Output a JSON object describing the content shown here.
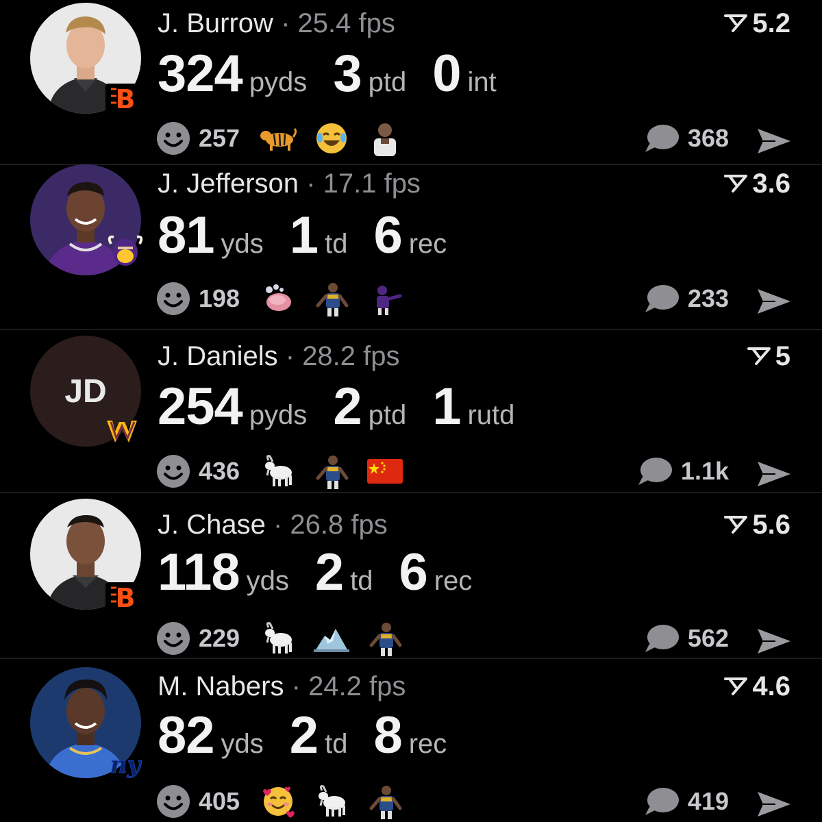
{
  "separator": "·",
  "cards": [
    {
      "name": "J. Burrow",
      "fps": "25.4 fps",
      "projection": "5.2",
      "stats": [
        {
          "value": "324",
          "unit": "pyds"
        },
        {
          "value": "3",
          "unit": "ptd"
        },
        {
          "value": "0",
          "unit": "int"
        }
      ],
      "reaction_count": "257",
      "reaction_emojis": [
        "tiger-emoji",
        "tears-of-joy-emoji",
        "player-sticker"
      ],
      "comment_count": "368",
      "team_icon": "bengals-logo-icon"
    },
    {
      "name": "J. Jefferson",
      "fps": "17.1 fps",
      "projection": "3.6",
      "stats": [
        {
          "value": "81",
          "unit": "yds"
        },
        {
          "value": "1",
          "unit": "td"
        },
        {
          "value": "6",
          "unit": "rec"
        }
      ],
      "reaction_count": "198",
      "reaction_emojis": [
        "soap-emoji",
        "player-sticker",
        "player-sticker"
      ],
      "comment_count": "233",
      "team_icon": "vikings-logo-icon"
    },
    {
      "name": "J. Daniels",
      "initials": "JD",
      "fps": "28.2 fps",
      "projection": "5",
      "stats": [
        {
          "value": "254",
          "unit": "pyds"
        },
        {
          "value": "2",
          "unit": "ptd"
        },
        {
          "value": "1",
          "unit": "rutd"
        }
      ],
      "reaction_count": "436",
      "reaction_emojis": [
        "goat-emoji",
        "player-sticker",
        "china-flag-emoji"
      ],
      "comment_count": "1.1k",
      "team_icon": "commanders-logo-icon"
    },
    {
      "name": "J. Chase",
      "fps": "26.8 fps",
      "projection": "5.6",
      "stats": [
        {
          "value": "118",
          "unit": "yds"
        },
        {
          "value": "2",
          "unit": "td"
        },
        {
          "value": "6",
          "unit": "rec"
        }
      ],
      "reaction_count": "229",
      "reaction_emojis": [
        "goat-emoji",
        "ice-emoji",
        "player-sticker"
      ],
      "comment_count": "562",
      "team_icon": "bengals-logo-icon"
    },
    {
      "name": "M. Nabers",
      "fps": "24.2 fps",
      "projection": "4.6",
      "stats": [
        {
          "value": "82",
          "unit": "yds"
        },
        {
          "value": "2",
          "unit": "td"
        },
        {
          "value": "8",
          "unit": "rec"
        }
      ],
      "reaction_count": "405",
      "reaction_emojis": [
        "smiling-face-with-hearts-emoji",
        "goat-emoji",
        "player-sticker"
      ],
      "comment_count": "419",
      "team_icon": "giants-logo-icon"
    }
  ],
  "colors": {
    "background": "#000000",
    "primary_text": "#e6e6e6",
    "secondary_text": "#8e8e93",
    "icon_gray": "#8e8e93",
    "divider": "#1c1c1e"
  }
}
